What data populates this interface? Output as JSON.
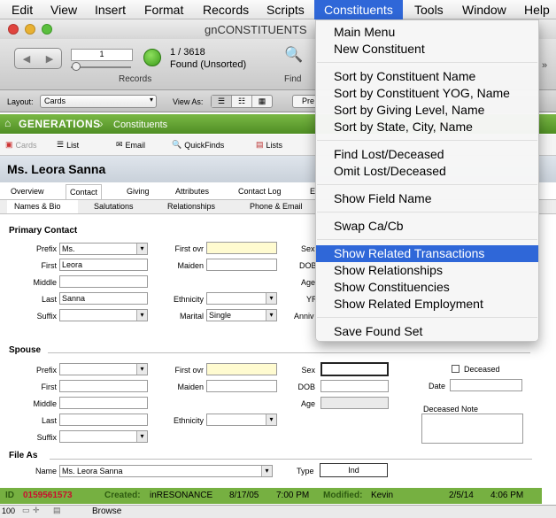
{
  "menubar": {
    "items": [
      "Edit",
      "View",
      "Insert",
      "Format",
      "Records",
      "Scripts",
      "Constituents",
      "Tools",
      "Window",
      "Help"
    ],
    "active": "Constituents"
  },
  "window": {
    "title": "gnCONSTITUENTS"
  },
  "toolbar": {
    "record_number": "1",
    "record_count": "1 / 3618",
    "found_status": "Found (Unsorted)",
    "records_label": "Records",
    "find_label": "Find"
  },
  "layoutbar": {
    "layout_label": "Layout:",
    "layout_value": "Cards",
    "view_as_label": "View As:",
    "partial_button": "Pre"
  },
  "app": {
    "brand": "GENERATIONS",
    "section": "Constituents"
  },
  "nav": {
    "cards": "Cards",
    "list": "List",
    "email": "Email",
    "quickfinds": "QuickFinds",
    "lists": "Lists"
  },
  "record": {
    "name": "Ms. Leora Sanna"
  },
  "tabs": [
    "Overview",
    "Contact",
    "Giving",
    "Attributes",
    "Contact Log",
    "E"
  ],
  "selected_tab": "Contact",
  "subtabs": [
    "Names & Bio",
    "Salutations",
    "Relationships",
    "Phone & Email"
  ],
  "primary_contact": {
    "title": "Primary Contact",
    "prefix_label": "Prefix",
    "prefix": "Ms.",
    "first_label": "First",
    "first": "Leora",
    "middle_label": "Middle",
    "middle": "",
    "last_label": "Last",
    "last": "Sanna",
    "suffix_label": "Suffix",
    "suffix": "",
    "first_ovr_label": "First ovr",
    "maiden_label": "Maiden",
    "ethnicity_label": "Ethnicity",
    "marital_label": "Marital",
    "marital": "Single",
    "sex_label": "Sex",
    "dob_label": "DOB",
    "age_label": "Age",
    "yr_label": "YR",
    "anniv_label": "Anniv"
  },
  "spouse": {
    "title": "Spouse",
    "prefix_label": "Prefix",
    "first_label": "First",
    "middle_label": "Middle",
    "last_label": "Last",
    "suffix_label": "Suffix",
    "first_ovr_label": "First ovr",
    "maiden_label": "Maiden",
    "ethnicity_label": "Ethnicity",
    "sex_label": "Sex",
    "dob_label": "DOB",
    "age_label": "Age",
    "deceased_label": "Deceased",
    "date_label": "Date",
    "deceased_note_label": "Deceased Note"
  },
  "file_as": {
    "title": "File As",
    "name_label": "Name",
    "name": "Ms. Leora Sanna",
    "type_label": "Type",
    "type": "Ind"
  },
  "footer": {
    "id_label": "ID",
    "id": "0159561573",
    "created_label": "Created:",
    "created_by": "inRESONANCE",
    "created_date": "8/17/05",
    "created_time": "7:00 PM",
    "modified_label": "Modified:",
    "modified_by": "Kevin",
    "modified_date": "2/5/14",
    "modified_time": "4:06 PM"
  },
  "statusbar": {
    "zoom": "100",
    "mode": "Browse"
  },
  "dropdown": {
    "groups": [
      [
        "Main Menu",
        "New Constituent"
      ],
      [
        "Sort by Constituent Name",
        "Sort by Constituent YOG, Name",
        "Sort by Giving Level, Name",
        "Sort by State, City, Name"
      ],
      [
        "Find Lost/Deceased",
        "Omit Lost/Deceased"
      ],
      [
        "Show Field Name"
      ],
      [
        "Swap Ca/Cb"
      ],
      [
        "Show Related Transactions",
        "Show Relationships",
        "Show Constituencies",
        "Show Related Employment"
      ],
      [
        "Save Found Set"
      ]
    ],
    "highlighted": "Show Related Transactions"
  },
  "colors": {
    "accent": "#2f67d8",
    "brand_green": "#5c9a2e",
    "id_red": "#c8102e"
  }
}
